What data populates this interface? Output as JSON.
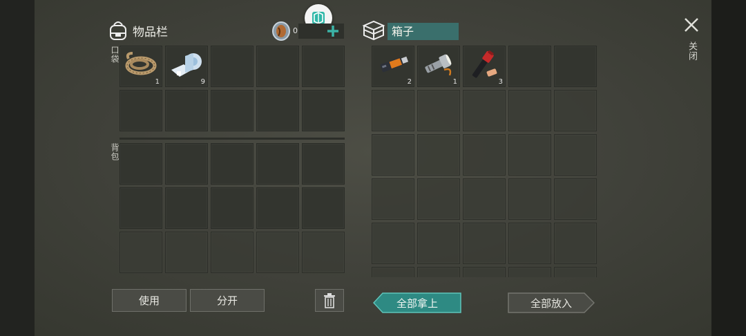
{
  "inventory": {
    "title": "物品栏",
    "coin_count": "0",
    "pocket_label": "口袋",
    "backpack_label": "背包",
    "pocket_slots": [
      {
        "icon": "rope-icon",
        "qty": "1"
      },
      {
        "icon": "bandage-icon",
        "qty": "9"
      },
      {
        "icon": "",
        "qty": ""
      },
      {
        "icon": "",
        "qty": ""
      },
      {
        "icon": "",
        "qty": ""
      },
      {
        "icon": "",
        "qty": ""
      },
      {
        "icon": "",
        "qty": ""
      },
      {
        "icon": "",
        "qty": ""
      },
      {
        "icon": "",
        "qty": ""
      },
      {
        "icon": "",
        "qty": ""
      }
    ],
    "use_label": "使用",
    "split_label": "分开"
  },
  "box": {
    "title": "箱子",
    "slots": [
      {
        "icon": "usb-drive-icon",
        "qty": "2"
      },
      {
        "icon": "flashlight-icon",
        "qty": "1"
      },
      {
        "icon": "flare-icon",
        "qty": "3"
      }
    ],
    "take_all_label": "全部拿上",
    "put_all_label": "全部放入"
  },
  "close_label": "关闭",
  "colors": {
    "accent": "#2f8f86",
    "add_plus": "#3bb3a6"
  }
}
